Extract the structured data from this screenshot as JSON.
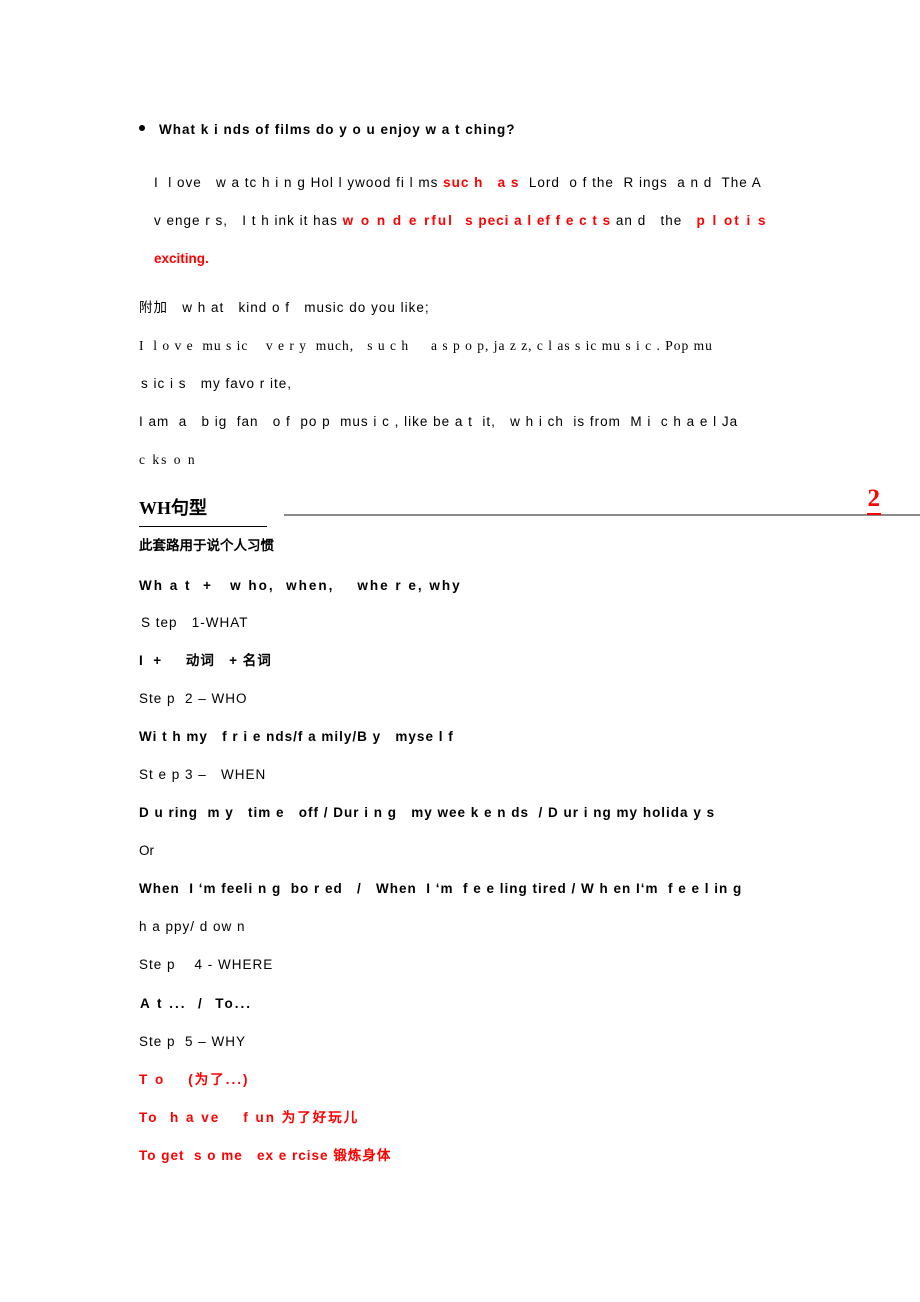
{
  "document": {
    "page_number": "2",
    "accent_red": "#ff0000",
    "rule_gray": "#8a8a8a"
  },
  "question_block": {
    "bullet_question": "What  k i nds of films do  y o u    enjoy w a t ching?",
    "answer_line_1_pre": "I  l ove   w a tc h i n g Hol l ywood fi l ms ",
    "answer_line_1_red": "suc h   a s",
    "answer_line_1_post": "  Lord  o f the  R ings  a n d  The A",
    "answer_line_2_pre": "v enge r s,   I t h ink it has ",
    "answer_line_2_red_a": "w o n d e rful",
    "answer_line_2_mid_a": "   ",
    "answer_line_2_red_b": "s peci a l ef f e c t s",
    "answer_line_2_mid_b": " an d   the   ",
    "answer_line_2_red_c": "p l ot i s",
    "answer_line_3_red": "exciting",
    "answer_line_3_post": "."
  },
  "extra_block": {
    "label_line": "附加   w h at   kind o f   music do you like;",
    "line_1": "I  l o v e  mu s ic    v e r y  much,   s u c h     a s p o p, ja z z, c l as s ic mu s i c . Pop mu",
    "line_2": "s ic i s   my favo r ite,",
    "line_3": "I am  a   b ig  fan   o f  po p  mus i c , like be a t  it,   w h i ch  is from  M i  c h a e l Ja",
    "line_4": "c ks o n"
  },
  "wh_section": {
    "heading": "WH句型",
    "subtitle": "此套路用于说个人习惯",
    "formula": "Wh a t  +   w ho,  when,    whe r e, why",
    "steps": [
      {
        "step_label": "S tep   1-WHAT",
        "content": "I  +     动词   + 名词",
        "content_bold": true,
        "content_red": false
      },
      {
        "step_label": "Ste p  2 – WHO",
        "content": "Wi t h my   f r i e nds/f a mily/B y   myse l f",
        "content_bold": true,
        "content_red": false
      },
      {
        "step_label": "St e p 3 –   WHEN",
        "content": "D u ring  m y   tim e   off / Dur i n g   my wee k e n ds  / D ur i ng my holida y s",
        "content_bold": true,
        "content_red": false
      }
    ],
    "or_label": "Or",
    "when_alt_line_1": "When  I ‘m feeli n g  bo r ed   /   When  I ‘m  f e e ling tired / W h en I‘m  f e e l in g",
    "when_alt_line_2": "h a ppy/ d ow n",
    "step_where_label": "Ste p    4 - WHERE",
    "step_where_content": "A t ...  /  To...",
    "step_why_label": "Ste p  5 – WHY",
    "why_items": [
      "T o    (为了...)",
      "To  h a ve    f un 为了好玩儿",
      "To get  s o me   ex e rcise 锻炼身体"
    ]
  }
}
